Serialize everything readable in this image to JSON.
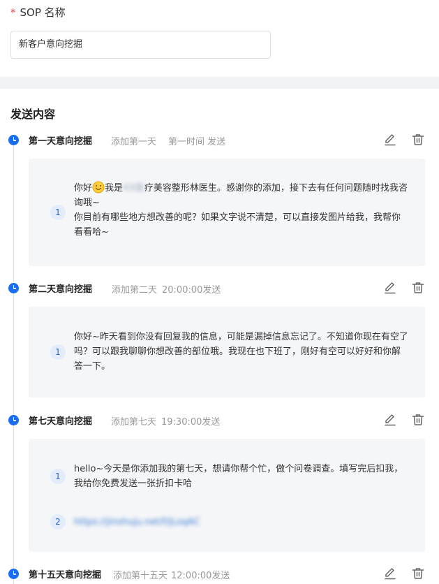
{
  "sop": {
    "required_mark": "*",
    "label": "SOP 名称",
    "value": "新客户意向挖掘"
  },
  "content": {
    "title": "发送内容"
  },
  "days": [
    {
      "title": "第一天意向挖掘",
      "add_label": "添加第一天",
      "time_label": "第一时间 发送",
      "messages": [
        {
          "num": "1",
          "pre": "你好",
          "emoji": "smile-emoji",
          "mid": "我是",
          "blur": "XX医",
          "post": "疗美容整形林医生。感谢你的添加，接下去有任何问题随时找我咨询哦~\n你目前有哪些地方想改善的呢？如果文字说不清楚，可以直接发图片给我，我帮你看看哈~"
        }
      ]
    },
    {
      "title": "第二天意向挖掘",
      "add_label": "添加第二天",
      "time_label": "20:00:00发送",
      "messages": [
        {
          "num": "1",
          "text": "你好~昨天看到你没有回复我的信息，可能是漏掉信息忘记了。不知道你现在有空了吗？可以跟我聊聊你想改善的部位哦。我现在也下班了，刚好有空可以好好和你解答一下。"
        }
      ]
    },
    {
      "title": "第七天意向挖掘",
      "add_label": "添加第七天",
      "time_label": "19:30:00发送",
      "messages": [
        {
          "num": "1",
          "text": "hello~今天是你添加我的第七天，想请你帮个忙，做个问卷调查。填写完后扣我，我给你免费发送一张折扣卡哈"
        },
        {
          "num": "2",
          "link": "https://jinshuju.net/f/jLoqAC"
        }
      ]
    },
    {
      "title": "第十五天意向挖掘",
      "add_label": "添加第十五天",
      "time_label": "12:00:00发送",
      "messages": []
    }
  ],
  "icons": {
    "edit": "edit-icon",
    "delete": "trash-icon",
    "timeline": "clock-icon"
  },
  "colors": {
    "accent": "#1a6cf0",
    "required": "#e34d4d",
    "card_bg": "#f5f6f8"
  }
}
